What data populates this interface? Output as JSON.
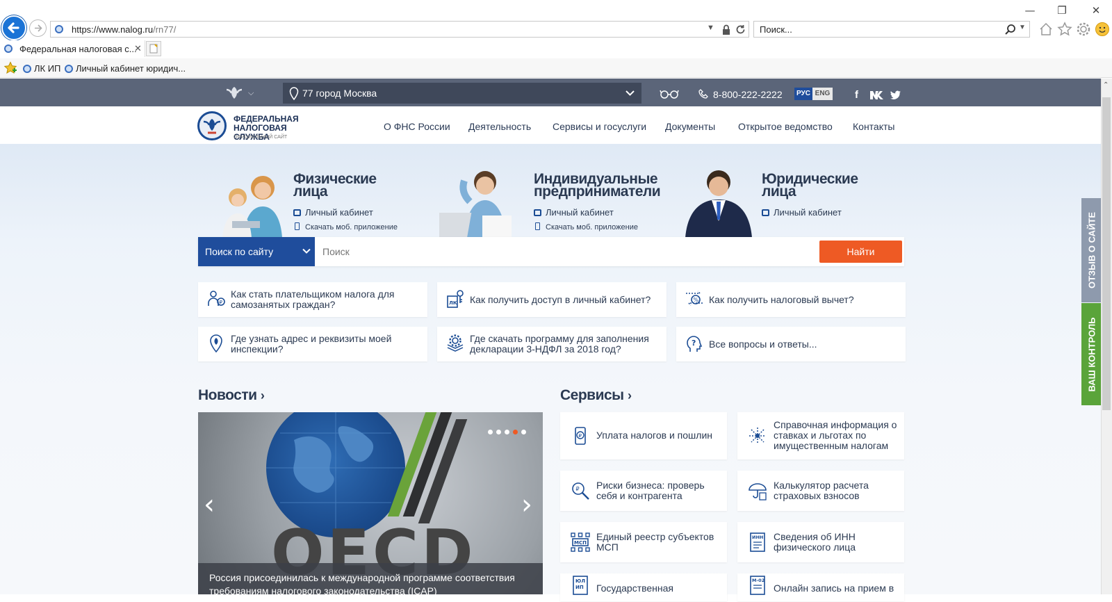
{
  "browser": {
    "url_main": "https://www.nalog.ru",
    "url_path": "/rn77/",
    "search_placeholder": "Поиск...",
    "tab_title": "Федеральная налоговая с...",
    "favorites": [
      "ЛК ИП",
      "Личный кабинет юридич..."
    ]
  },
  "topbar": {
    "region": "77 город Москва",
    "phone": "8-800-222-2222",
    "lang_ru": "РУС",
    "lang_en": "ENG"
  },
  "logo": {
    "line1": "ФЕДЕРАЛЬНАЯ НАЛОГОВАЯ СЛУЖБА",
    "line2": "ОФИЦИАЛЬНЫЙ САЙТ"
  },
  "nav": [
    "О ФНС России",
    "Деятельность",
    "Сервисы и госуслуги",
    "Документы",
    "Открытое ведомство",
    "Контакты"
  ],
  "segments": [
    {
      "title": "Физические лица",
      "cabinet": "Личный кабинет",
      "app": "Скачать моб. приложение"
    },
    {
      "title": "Индивидуальные предприниматели",
      "cabinet": "Личный кабинет",
      "app": "Скачать моб. приложение"
    },
    {
      "title": "Юридические лица",
      "cabinet": "Личный кабинет"
    }
  ],
  "search": {
    "scope": "Поиск по сайту",
    "placeholder": "Поиск",
    "button": "Найти"
  },
  "quick_links": [
    "Как стать плательщиком налога для самозанятых граждан?",
    "Как получить доступ в личный кабинет?",
    "Как получить налоговый вычет?",
    "Где узнать адрес и реквизиты моей инспекции?",
    "Где скачать программу для заполнения декларации 3-НДФЛ за 2018 год?",
    "Все вопросы и ответы..."
  ],
  "news": {
    "title": "Новости",
    "caption": "Россия присоединилась к международной программе соответствия требованиям налогового законодательства (ICAP)",
    "slide_text": "OECD",
    "slides": 5,
    "active_slide": 4
  },
  "services": {
    "title": "Сервисы",
    "items": [
      "Уплата налогов и пошлин",
      "Справочная информация о ставках и льготах по имущественным налогам",
      "Риски бизнеса: проверь себя и контрагента",
      "Калькулятор расчета страховых взносов",
      "Единый реестр субъектов МСП",
      "Сведения об ИНН физического лица",
      "Государственная",
      "Онлайн запись на прием в"
    ]
  },
  "side_tabs": {
    "feedback": "ОТЗЫВ О САЙТЕ",
    "control": "ВАШ КОНТРОЛЬ"
  },
  "colors": {
    "topbar": "#5b6579",
    "brand_blue": "#1f4d9c",
    "accent_orange": "#ee5a24",
    "control_green": "#5aa43a"
  }
}
